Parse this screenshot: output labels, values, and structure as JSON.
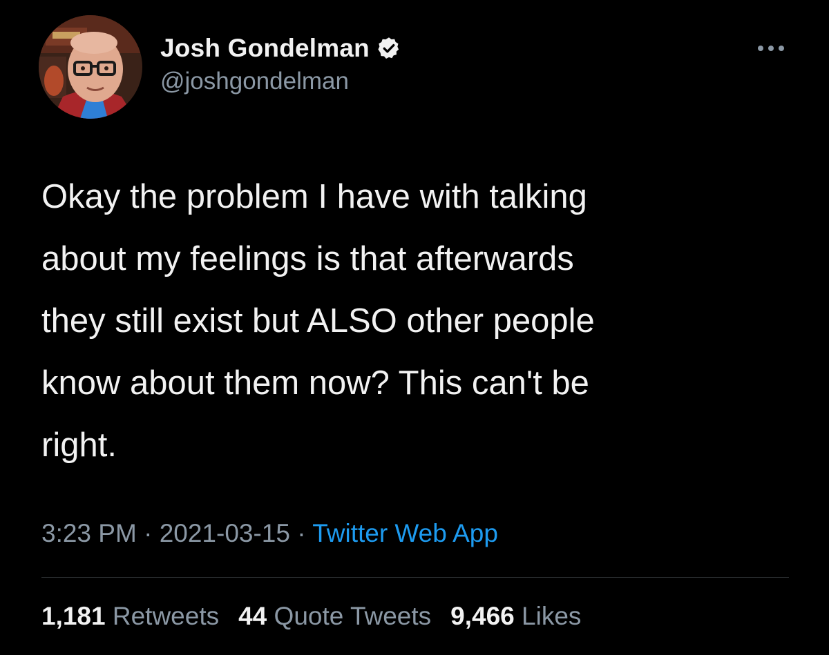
{
  "author": {
    "display_name": "Josh Gondelman",
    "handle": "@joshgondelman",
    "verified_icon": "verified-badge-icon",
    "avatar": "avatar-photo"
  },
  "more_icon": "more-options-icon",
  "tweet": {
    "text": "Okay the problem I have with talking\nabout my feelings is that afterwards\nthey still exist but ALSO other people\nknow about them now? This can't be\nright.",
    "time": "3:23 PM",
    "separator": "·",
    "date": "2021-03-15",
    "source": "Twitter Web App"
  },
  "stats": {
    "retweets_count": "1,181",
    "retweets_label": "Retweets",
    "quote_count": "44",
    "quote_label": "Quote Tweets",
    "likes_count": "9,466",
    "likes_label": "Likes"
  },
  "colors": {
    "background": "#000000",
    "text": "#f2f2f2",
    "secondary": "#8b98a5",
    "link": "#1d9bf0",
    "divider": "#2f3336"
  }
}
